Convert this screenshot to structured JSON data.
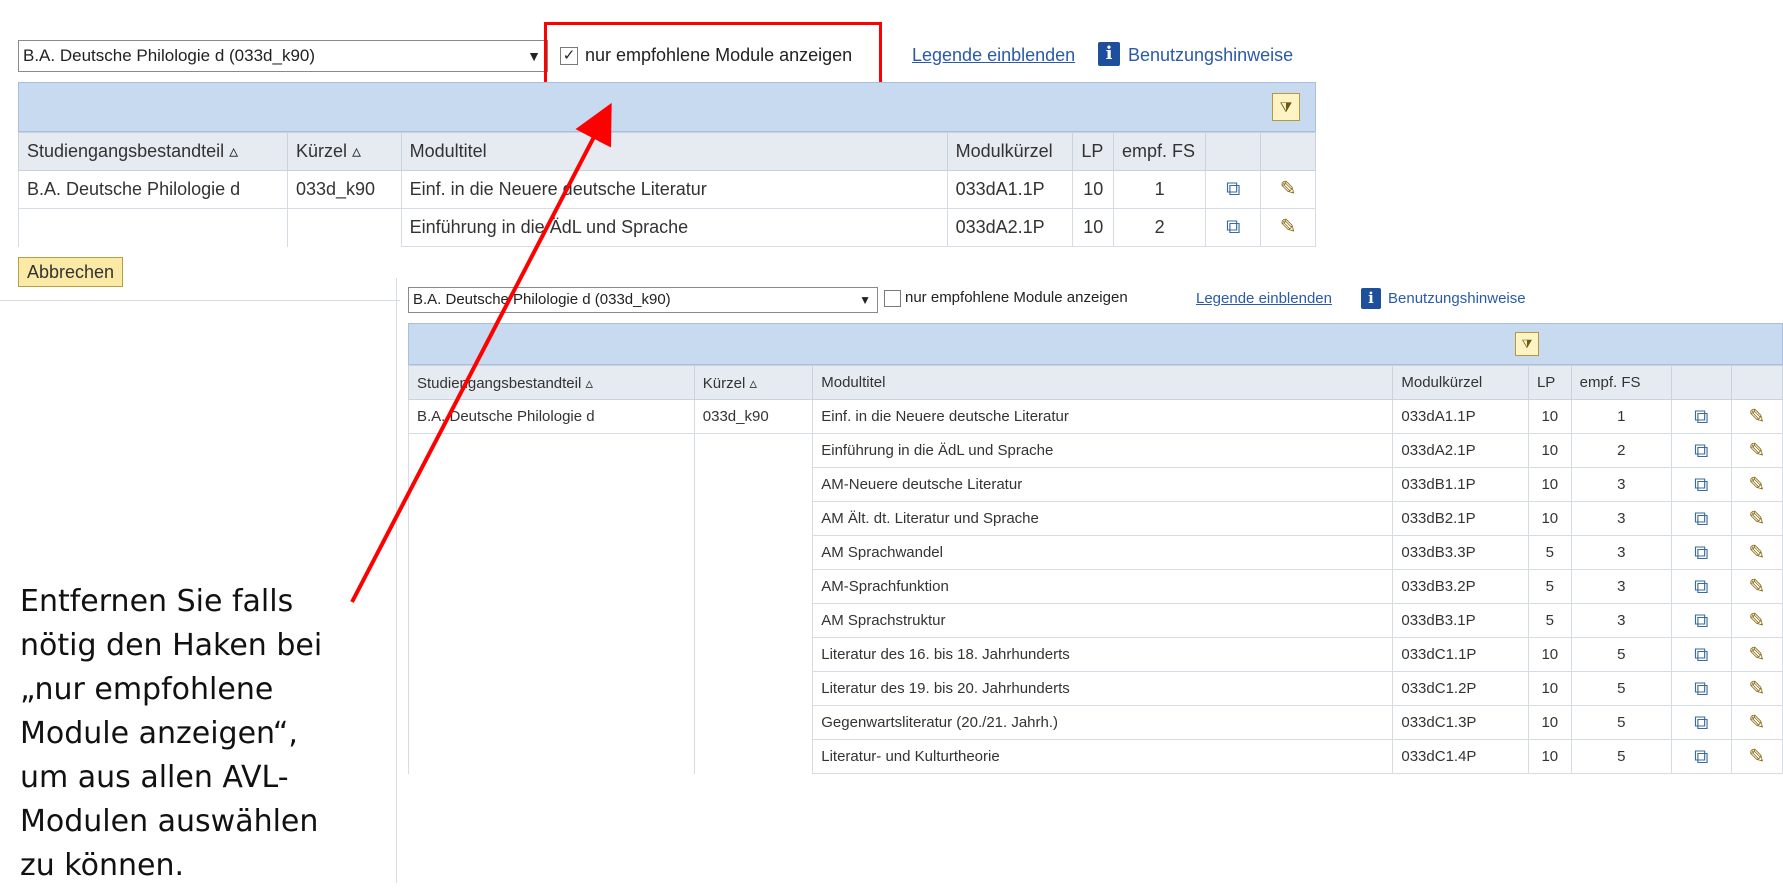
{
  "top": {
    "program_select": "B.A. Deutsche Philologie d (033d_k90)",
    "checkbox_checked": true,
    "checkbox_mark": "✓",
    "checkbox_label": "nur empfohlene Module anzeigen",
    "legend_link": "Legende einblenden",
    "info_icon": "i",
    "help_link": "Benutzungshinweise",
    "columns": [
      "Studiengangsbestandteil ▵",
      "Kürzel ▵",
      "Modultitel",
      "Modulkürzel",
      "LP",
      "empf. FS",
      "",
      ""
    ],
    "rows": [
      {
        "bestandteil": "B.A. Deutsche Philologie d",
        "kuerzel": "033d_k90",
        "titel": "Einf. in die Neuere deutsche Literatur",
        "modulkuerzel": "033dA1.1P",
        "lp": "10",
        "fs": "1"
      },
      {
        "bestandteil": "",
        "kuerzel": "",
        "titel": "Einführung in die ÄdL und Sprache",
        "modulkuerzel": "033dA2.1P",
        "lp": "10",
        "fs": "2"
      }
    ],
    "cancel_button": "Abbrechen"
  },
  "bottom": {
    "program_select": "B.A. Deutsche Philologie d (033d_k90)",
    "checkbox_checked": false,
    "checkbox_label": "nur empfohlene Module anzeigen",
    "legend_link": "Legende einblenden",
    "info_icon": "i",
    "help_link": "Benutzungshinweise",
    "columns": [
      "Studiengangsbestandteil ▵",
      "Kürzel ▵",
      "Modultitel",
      "Modulkürzel",
      "LP",
      "empf. FS",
      "",
      ""
    ],
    "rows": [
      {
        "bestandteil": "B.A. Deutsche Philologie d",
        "kuerzel": "033d_k90",
        "titel": "Einf. in die Neuere deutsche Literatur",
        "modulkuerzel": "033dA1.1P",
        "lp": "10",
        "fs": "1"
      },
      {
        "bestandteil": "",
        "kuerzel": "",
        "titel": "Einführung in die ÄdL und Sprache",
        "modulkuerzel": "033dA2.1P",
        "lp": "10",
        "fs": "2"
      },
      {
        "bestandteil": "",
        "kuerzel": "",
        "titel": "AM-Neuere deutsche Literatur",
        "modulkuerzel": "033dB1.1P",
        "lp": "10",
        "fs": "3"
      },
      {
        "bestandteil": "",
        "kuerzel": "",
        "titel": "AM Ält. dt. Literatur und Sprache",
        "modulkuerzel": "033dB2.1P",
        "lp": "10",
        "fs": "3"
      },
      {
        "bestandteil": "",
        "kuerzel": "",
        "titel": "AM Sprachwandel",
        "modulkuerzel": "033dB3.3P",
        "lp": "5",
        "fs": "3"
      },
      {
        "bestandteil": "",
        "kuerzel": "",
        "titel": "AM-Sprachfunktion",
        "modulkuerzel": "033dB3.2P",
        "lp": "5",
        "fs": "3"
      },
      {
        "bestandteil": "",
        "kuerzel": "",
        "titel": "AM Sprachstruktur",
        "modulkuerzel": "033dB3.1P",
        "lp": "5",
        "fs": "3"
      },
      {
        "bestandteil": "",
        "kuerzel": "",
        "titel": "Literatur des 16. bis 18. Jahrhunderts",
        "modulkuerzel": "033dC1.1P",
        "lp": "10",
        "fs": "5"
      },
      {
        "bestandteil": "",
        "kuerzel": "",
        "titel": "Literatur des 19. bis 20. Jahrhunderts",
        "modulkuerzel": "033dC1.2P",
        "lp": "10",
        "fs": "5"
      },
      {
        "bestandteil": "",
        "kuerzel": "",
        "titel": "Gegenwartsliteratur (20./21. Jahrh.)",
        "modulkuerzel": "033dC1.3P",
        "lp": "10",
        "fs": "5"
      },
      {
        "bestandteil": "",
        "kuerzel": "",
        "titel": "Literatur- und Kulturtheorie",
        "modulkuerzel": "033dC1.4P",
        "lp": "10",
        "fs": "5"
      }
    ]
  },
  "annotation": {
    "lines": [
      "Entfernen Sie falls",
      "nötig den Haken bei",
      "„nur empfohlene",
      "Module anzeigen“,",
      "um aus allen AVL-",
      "Modulen auswählen",
      "zu können."
    ],
    "arrow_color": "#ff0000",
    "highlight_color": "#ff0000"
  },
  "icons": {
    "view": "view-details-icon",
    "edit": "edit-pencil-icon",
    "filter": "filter-icon",
    "info": "info-icon"
  }
}
